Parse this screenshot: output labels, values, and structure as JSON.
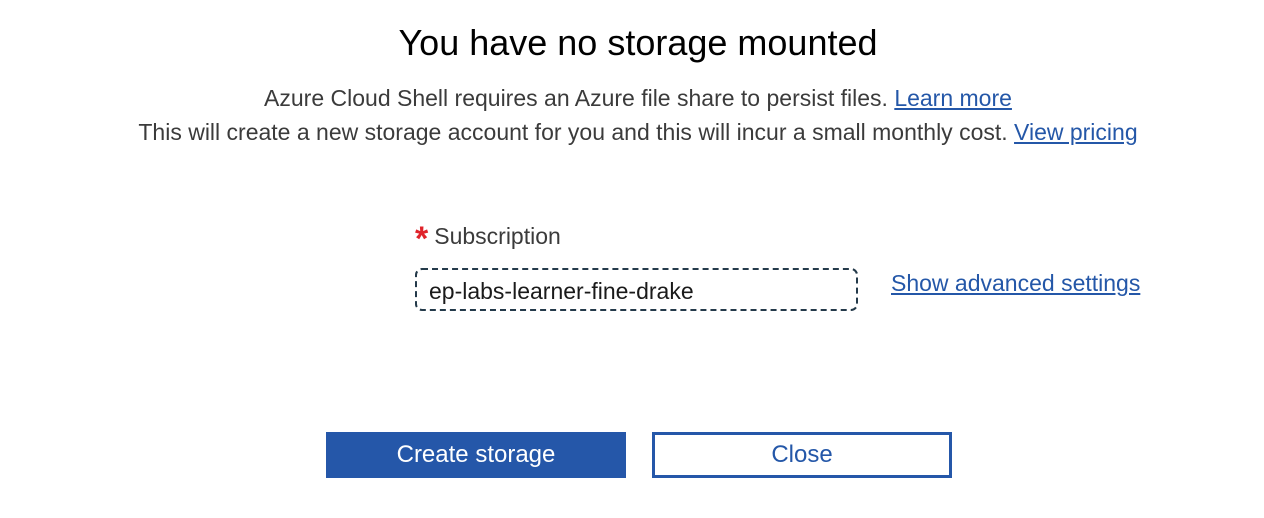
{
  "dialog": {
    "title": "You have no storage mounted",
    "description_line1": "Azure Cloud Shell requires an Azure file share to persist files.",
    "learn_more_link": "Learn more",
    "description_line2": "This will create a new storage account for you and this will incur a small monthly cost.",
    "view_pricing_link": "View pricing"
  },
  "form": {
    "required_marker": "*",
    "subscription_label": "Subscription",
    "subscription_value": "ep-labs-learner-fine-drake",
    "advanced_settings_link": "Show advanced settings"
  },
  "actions": {
    "create_label": "Create storage",
    "close_label": "Close"
  },
  "colors": {
    "accent": "#2557a9",
    "link": "#2457a8",
    "required": "#e0242b"
  }
}
